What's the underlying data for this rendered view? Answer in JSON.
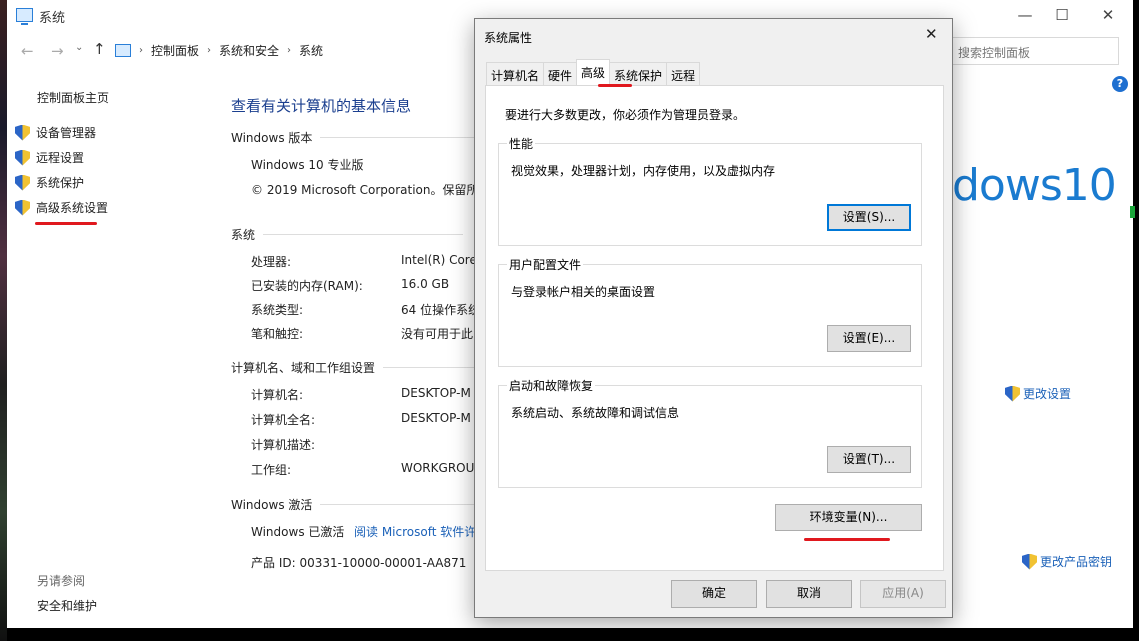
{
  "window": {
    "title": "系统"
  },
  "address": {
    "crumbs": [
      "控制面板",
      "系统和安全",
      "系统"
    ],
    "search_placeholder": "搜索控制面板"
  },
  "left_nav": {
    "home": "控制面板主页",
    "items": [
      "设备管理器",
      "远程设置",
      "系统保护",
      "高级系统设置"
    ],
    "see_also": "另请参阅",
    "security": "安全和维护"
  },
  "main": {
    "title": "查看有关计算机的基本信息",
    "edition_head": "Windows 版本",
    "edition": "Windows 10 专业版",
    "copyright": "© 2019 Microsoft Corporation。保留所",
    "system_head": "系统",
    "system_rows": [
      {
        "k": "处理器:",
        "v": "Intel(R) Core"
      },
      {
        "k": "已安装的内存(RAM):",
        "v": "16.0 GB"
      },
      {
        "k": "系统类型:",
        "v": "64 位操作系统"
      },
      {
        "k": "笔和触控:",
        "v": "没有可用于此"
      }
    ],
    "name_head": "计算机名、域和工作组设置",
    "name_rows": [
      {
        "k": "计算机名:",
        "v": "DESKTOP-M"
      },
      {
        "k": "计算机全名:",
        "v": "DESKTOP-M"
      },
      {
        "k": "计算机描述:",
        "v": ""
      },
      {
        "k": "工作组:",
        "v": "WORKGROU"
      }
    ],
    "activation_head": "Windows 激活",
    "activated": "Windows 已激活",
    "license_link": "阅读 Microsoft 软件许",
    "product_id": "产品 ID: 00331-10000-00001-AA871",
    "logo": "dows10",
    "change_settings": "更改设置",
    "change_key": "更改产品密钥"
  },
  "dialog": {
    "title": "系统属性",
    "tabs": [
      "计算机名",
      "硬件",
      "高级",
      "系统保护",
      "远程"
    ],
    "active_tab": "高级",
    "note": "要进行大多数更改，你必须作为管理员登录。",
    "groups": [
      {
        "title": "性能",
        "desc": "视觉效果，处理器计划，内存使用，以及虚拟内存",
        "button": "设置(S)..."
      },
      {
        "title": "用户配置文件",
        "desc": "与登录帐户相关的桌面设置",
        "button": "设置(E)..."
      },
      {
        "title": "启动和故障恢复",
        "desc": "系统启动、系统故障和调试信息",
        "button": "设置(T)..."
      }
    ],
    "env_button": "环境变量(N)...",
    "ok": "确定",
    "cancel": "取消",
    "apply": "应用(A)"
  },
  "annotation_color": "#e0181e"
}
